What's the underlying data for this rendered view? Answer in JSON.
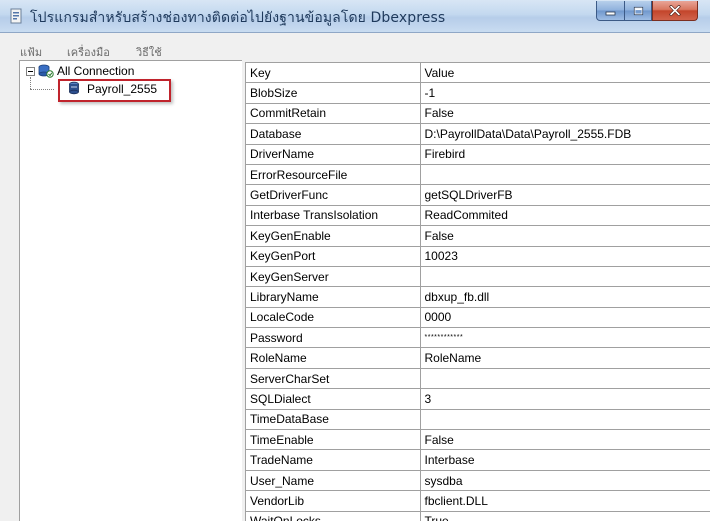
{
  "window": {
    "title": "โปรแกรมสำหรับสร้างช่องทางติดต่อไปยังฐานข้อมูลโดย Dbexpress"
  },
  "menu": [
    {
      "label": "แฟ้ม"
    },
    {
      "label": "เครื่องมือ"
    },
    {
      "label": "วิธีใช้"
    }
  ],
  "tree": {
    "root": {
      "label": "All Connection",
      "icon": "database-connection-icon"
    },
    "children": [
      {
        "label": "Payroll_2555",
        "icon": "database-icon",
        "highlighted": true
      }
    ]
  },
  "grid": {
    "columns": [
      "Key",
      "Value"
    ],
    "rows": [
      {
        "key": "BlobSize",
        "value": "-1"
      },
      {
        "key": "CommitRetain",
        "value": "False"
      },
      {
        "key": "Database",
        "value": "D:\\PayrollData\\Data\\Payroll_2555.FDB"
      },
      {
        "key": "DriverName",
        "value": "Firebird"
      },
      {
        "key": "ErrorResourceFile",
        "value": ""
      },
      {
        "key": "GetDriverFunc",
        "value": "getSQLDriverFB"
      },
      {
        "key": "Interbase TransIsolation",
        "value": "ReadCommited"
      },
      {
        "key": "KeyGenEnable",
        "value": "False"
      },
      {
        "key": "KeyGenPort",
        "value": "10023"
      },
      {
        "key": "KeyGenServer",
        "value": ""
      },
      {
        "key": "LibraryName",
        "value": "dbxup_fb.dll"
      },
      {
        "key": "LocaleCode",
        "value": "0000"
      },
      {
        "key": "Password",
        "value": "************"
      },
      {
        "key": "RoleName",
        "value": "RoleName"
      },
      {
        "key": "ServerCharSet",
        "value": ""
      },
      {
        "key": "SQLDialect",
        "value": "3"
      },
      {
        "key": "TimeDataBase",
        "value": ""
      },
      {
        "key": "TimeEnable",
        "value": "False"
      },
      {
        "key": "TradeName",
        "value": "Interbase"
      },
      {
        "key": "User_Name",
        "value": "sysdba"
      },
      {
        "key": "VendorLib",
        "value": "fbclient.DLL"
      },
      {
        "key": "WaitOnLocks",
        "value": "True"
      }
    ]
  },
  "colors": {
    "highlight_border": "#c0232c",
    "close_button": "#c3452b",
    "titlebar": "#c3d8ef"
  }
}
